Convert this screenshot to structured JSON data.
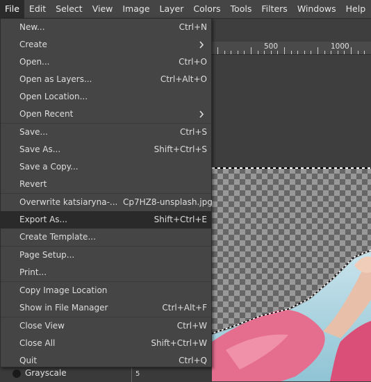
{
  "menubar": {
    "items": [
      {
        "label": "File",
        "active": true
      },
      {
        "label": "Edit"
      },
      {
        "label": "Select"
      },
      {
        "label": "View"
      },
      {
        "label": "Image"
      },
      {
        "label": "Layer"
      },
      {
        "label": "Colors"
      },
      {
        "label": "Tools"
      },
      {
        "label": "Filters"
      },
      {
        "label": "Windows"
      },
      {
        "label": "Help"
      }
    ]
  },
  "ruler": {
    "label_500": "500",
    "label_1000": "1000"
  },
  "file_menu": {
    "items": [
      {
        "label": "New...",
        "shortcut": "Ctrl+N"
      },
      {
        "label": "Create",
        "submenu": true
      },
      {
        "label": "Open...",
        "shortcut": "Ctrl+O"
      },
      {
        "label": "Open as Layers...",
        "shortcut": "Ctrl+Alt+O"
      },
      {
        "label": "Open Location...",
        "shortcut": ""
      },
      {
        "label": "Open Recent",
        "submenu": true
      },
      {
        "label": "Save...",
        "shortcut": "Ctrl+S"
      },
      {
        "label": "Save As...",
        "shortcut": "Shift+Ctrl+S"
      },
      {
        "label": "Save a Copy...",
        "shortcut": ""
      },
      {
        "label": "Revert",
        "shortcut": ""
      },
      {
        "label": "Overwrite katsiaryna-...  Cp7HZ8-unsplash.jpg",
        "shortcut": ""
      },
      {
        "label": "Export As...",
        "shortcut": "Shift+Ctrl+E",
        "highlighted": true
      },
      {
        "label": "Create Template...",
        "shortcut": ""
      },
      {
        "label": "Page Setup...",
        "shortcut": ""
      },
      {
        "label": "Print...",
        "shortcut": ""
      },
      {
        "label": "Copy Image Location",
        "shortcut": ""
      },
      {
        "label": "Show in File Manager",
        "shortcut": "Ctrl+Alt+F"
      },
      {
        "label": "Close View",
        "shortcut": "Ctrl+W"
      },
      {
        "label": "Close All",
        "shortcut": "Shift+Ctrl+W"
      },
      {
        "label": "Quit",
        "shortcut": "Ctrl+Q"
      }
    ]
  },
  "bottom_panel": {
    "grayscale_label": "Grayscale",
    "mini_ruler_label": "5"
  }
}
